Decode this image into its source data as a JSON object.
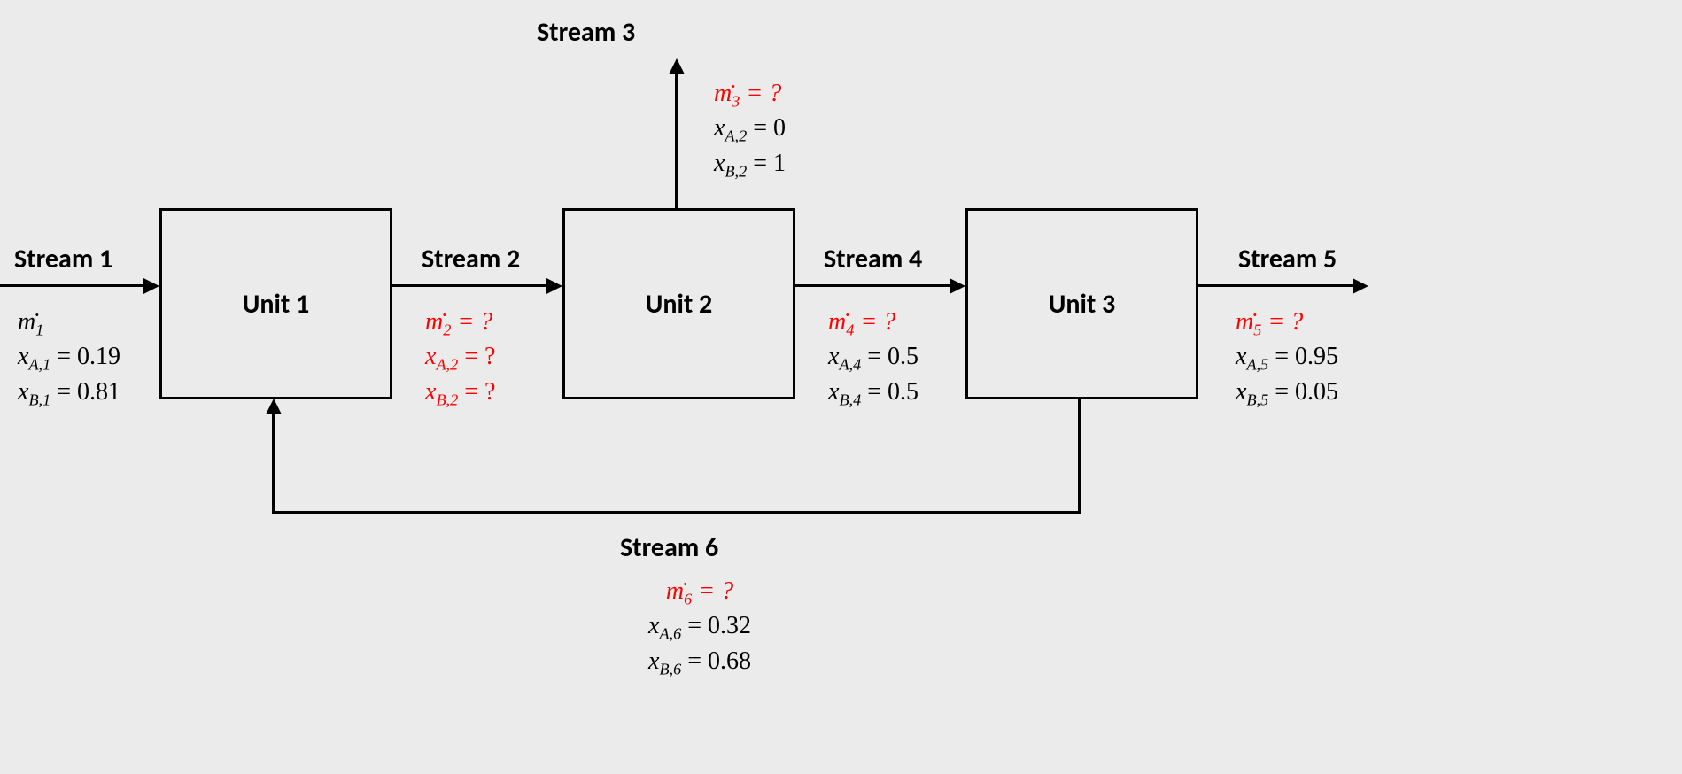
{
  "units": {
    "unit1": "Unit 1",
    "unit2": "Unit 2",
    "unit3": "Unit 3"
  },
  "streams": {
    "s1": {
      "title": "Stream 1",
      "mdot_label": "ṁ",
      "mdot_sub": "1",
      "mdot_unknown": false,
      "xA_label": "x",
      "xA_sub": "A,1",
      "xA_val": "0.19",
      "xB_label": "x",
      "xB_sub": "B,1",
      "xB_val": "0.81"
    },
    "s2": {
      "title": "Stream 2",
      "mdot_sub": "2",
      "mdot_unknown": true,
      "xA_sub": "A,2",
      "xA_unknown": true,
      "xB_sub": "B,2",
      "xB_unknown": true
    },
    "s3": {
      "title": "Stream 3",
      "mdot_sub": "3",
      "mdot_unknown": true,
      "xA_sub": "A,2",
      "xA_val": "0",
      "xB_sub": "B,2",
      "xB_val": "1"
    },
    "s4": {
      "title": "Stream 4",
      "mdot_sub": "4",
      "mdot_unknown": true,
      "xA_sub": "A,4",
      "xA_val": "0.5",
      "xB_sub": "B,4",
      "xB_val": "0.5"
    },
    "s5": {
      "title": "Stream 5",
      "mdot_sub": "5",
      "mdot_unknown": true,
      "xA_sub": "A,5",
      "xA_val": "0.95",
      "xB_sub": "B,5",
      "xB_val": "0.05"
    },
    "s6": {
      "title": "Stream 6",
      "mdot_sub": "6",
      "mdot_unknown": true,
      "xA_sub": "A,6",
      "xA_val": "0.32",
      "xB_sub": "B,6",
      "xB_val": "0.68"
    }
  }
}
